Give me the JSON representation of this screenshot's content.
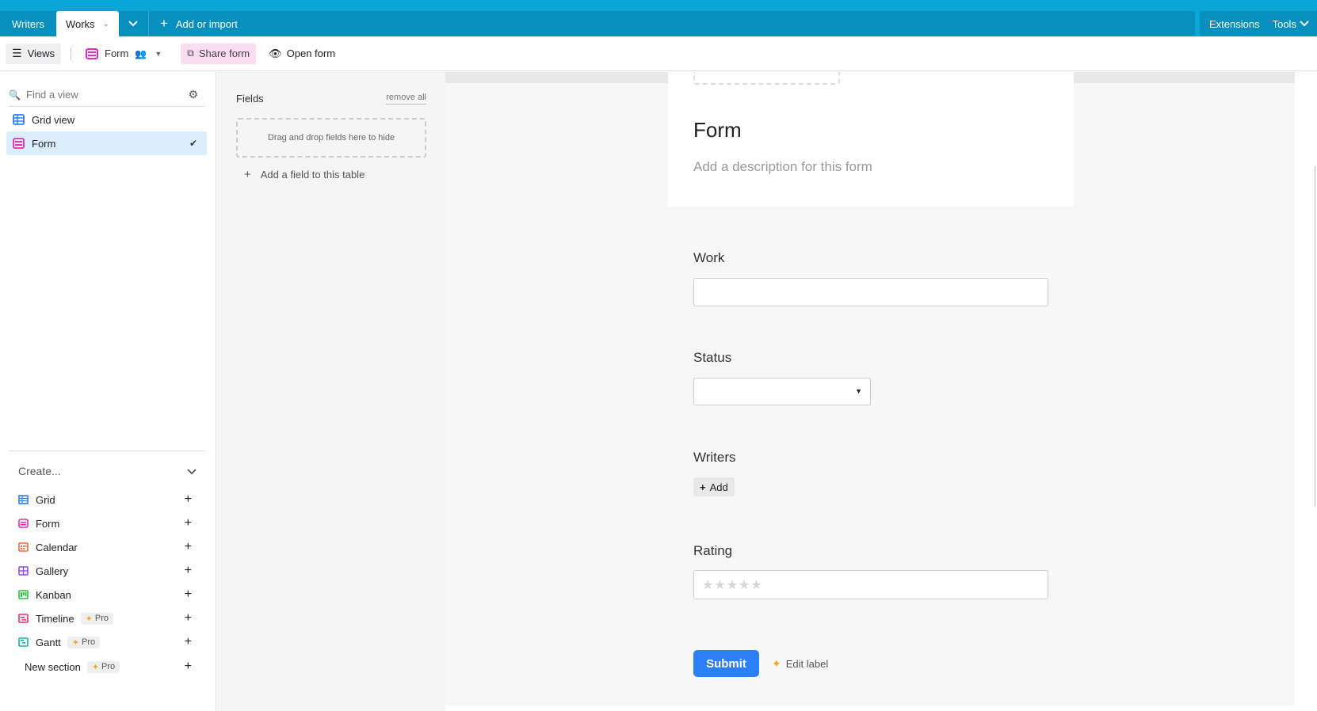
{
  "top_tabs": {
    "tabs": [
      {
        "label": "Writers"
      },
      {
        "label": "Works"
      }
    ],
    "add_import_label": "Add or import",
    "extensions_label": "Extensions",
    "tools_label": "Tools"
  },
  "viewbar": {
    "views_label": "Views",
    "current_view_label": "Form",
    "share_form_label": "Share form",
    "open_form_label": "Open form"
  },
  "sidebar": {
    "find_placeholder": "Find a view",
    "views": [
      {
        "label": "Grid view",
        "icon": "grid-icon",
        "color": "#2d7ff9"
      },
      {
        "label": "Form",
        "icon": "form-icon",
        "color": "#e929ba",
        "selected": true
      }
    ],
    "create_label": "Create...",
    "create_items": [
      {
        "label": "Grid",
        "icon": "grid-icon",
        "color": "#2d7ff9"
      },
      {
        "label": "Form",
        "icon": "form-icon",
        "color": "#e929ba"
      },
      {
        "label": "Calendar",
        "icon": "calendar-icon",
        "color": "#f7653b"
      },
      {
        "label": "Gallery",
        "icon": "gallery-icon",
        "color": "#8b46ff"
      },
      {
        "label": "Kanban",
        "icon": "kanban-icon",
        "color": "#20c933"
      },
      {
        "label": "Timeline",
        "icon": "timeline-icon",
        "color": "#f82b60",
        "badge": "Pro"
      },
      {
        "label": "Gantt",
        "icon": "gantt-icon",
        "color": "#18bfff",
        "badge": "Pro"
      },
      {
        "label": "New section",
        "badge": "Pro"
      }
    ]
  },
  "fields_panel": {
    "title": "Fields",
    "remove_all_label": "remove all",
    "dropzone_text": "Drag and drop fields here to hide",
    "add_field_label": "Add a field to this table"
  },
  "form": {
    "title": "Form",
    "description_placeholder": "Add a description for this form",
    "fields": [
      {
        "label": "Work",
        "type": "text"
      },
      {
        "label": "Status",
        "type": "select"
      },
      {
        "label": "Writers",
        "type": "link",
        "button_label": "Add"
      },
      {
        "label": "Rating",
        "type": "rating",
        "max": 5,
        "value": 0
      }
    ],
    "submit_label": "Submit",
    "edit_label": "Edit label"
  },
  "colors": {
    "topbar": "#0aa6d6",
    "accent": "#2d7ff9",
    "share_bg": "#fbdcf0",
    "selected_view_bg": "#dceefb"
  }
}
